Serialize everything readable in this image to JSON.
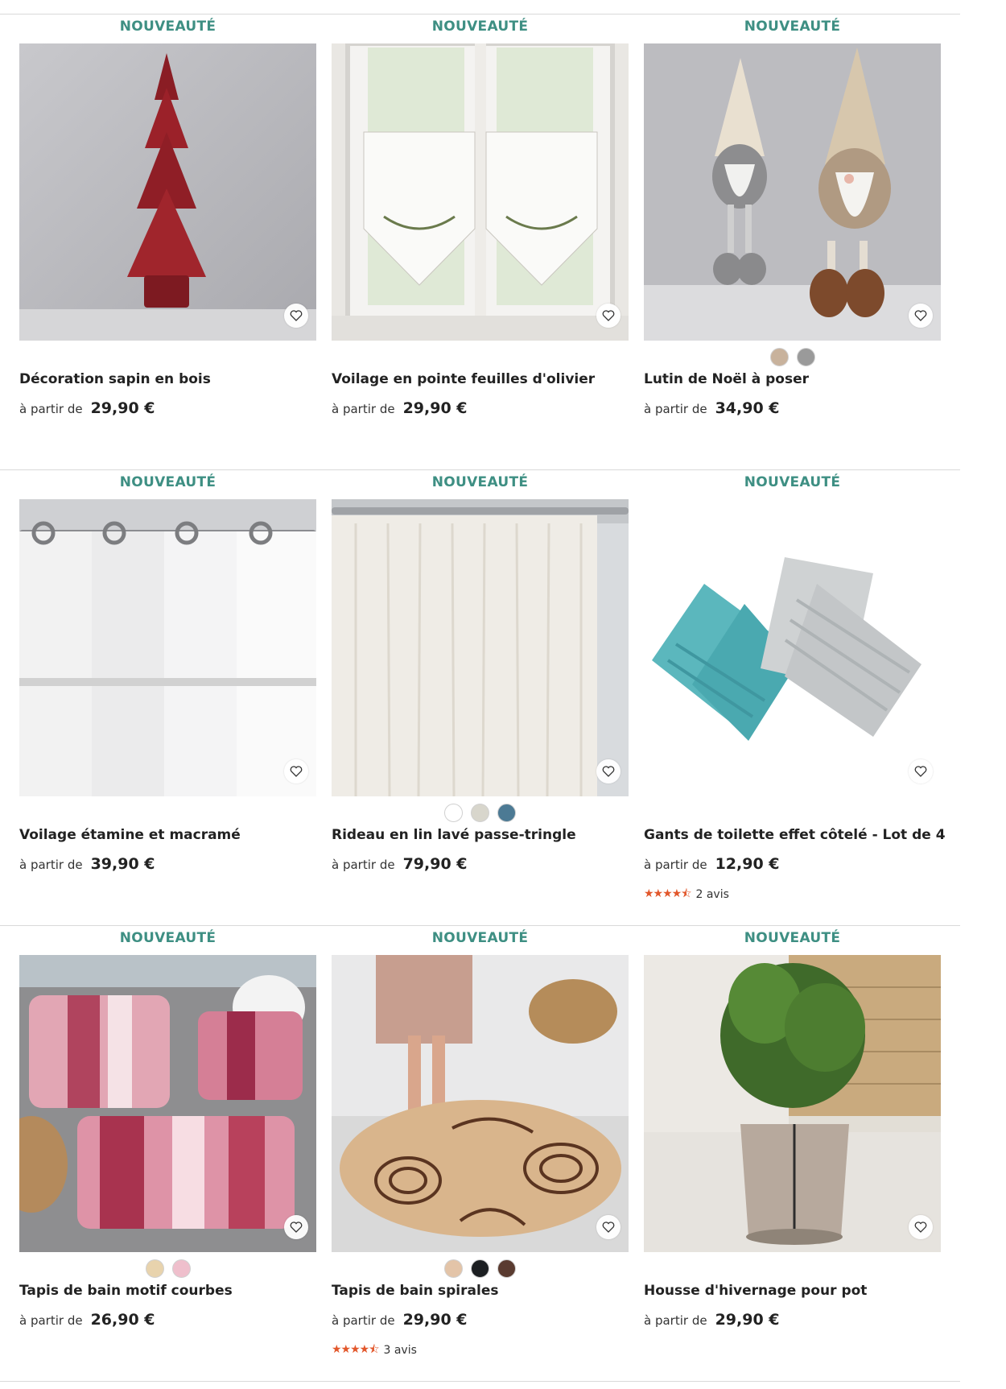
{
  "badge_label": "NOUVEAUTÉ",
  "from_label": "à partir de",
  "products": [
    {
      "name": "Décoration sapin en bois",
      "price": "29,90 €",
      "image": "red-wooden-tree",
      "swatches": [],
      "rating": null
    },
    {
      "name": "Voilage en pointe feuilles d'olivier",
      "price": "29,90 €",
      "image": "olive-leaf-curtain",
      "swatches": [],
      "rating": null
    },
    {
      "name": "Lutin de Noël à poser",
      "price": "34,90 €",
      "image": "christmas-gnomes",
      "swatches": [
        "#c8b29c",
        "#9a9a9a"
      ],
      "rating": null
    },
    {
      "name": "Voilage étamine et macramé",
      "price": "39,90 €",
      "image": "white-voile-curtain",
      "swatches": [],
      "rating": null
    },
    {
      "name": "Rideau en lin lavé passe-tringle",
      "price": "79,90 €",
      "image": "linen-curtain",
      "swatches": [
        "#ffffff",
        "#d8d6cc",
        "#4c7a94"
      ],
      "rating": null
    },
    {
      "name": "Gants de toilette effet côtelé - Lot de 4",
      "price": "12,90 €",
      "image": "wash-gloves",
      "swatches": [],
      "rating": {
        "stars": 4.5,
        "reviews": "2 avis"
      }
    },
    {
      "name": "Tapis de bain motif courbes",
      "price": "26,90 €",
      "image": "pink-bath-mats",
      "swatches": [
        "#e8d3ad",
        "#efbfcc"
      ],
      "rating": null
    },
    {
      "name": "Tapis de bain spirales",
      "price": "29,90 €",
      "image": "spiral-bath-mat",
      "swatches": [
        "#e3c4a8",
        "#1c1f22",
        "#5a3b30"
      ],
      "rating": {
        "stars": 4.5,
        "reviews": "3 avis"
      }
    },
    {
      "name": "Housse d'hivernage pour pot",
      "price": "29,90 €",
      "image": "winter-pot-cover",
      "swatches": [],
      "rating": null
    }
  ]
}
